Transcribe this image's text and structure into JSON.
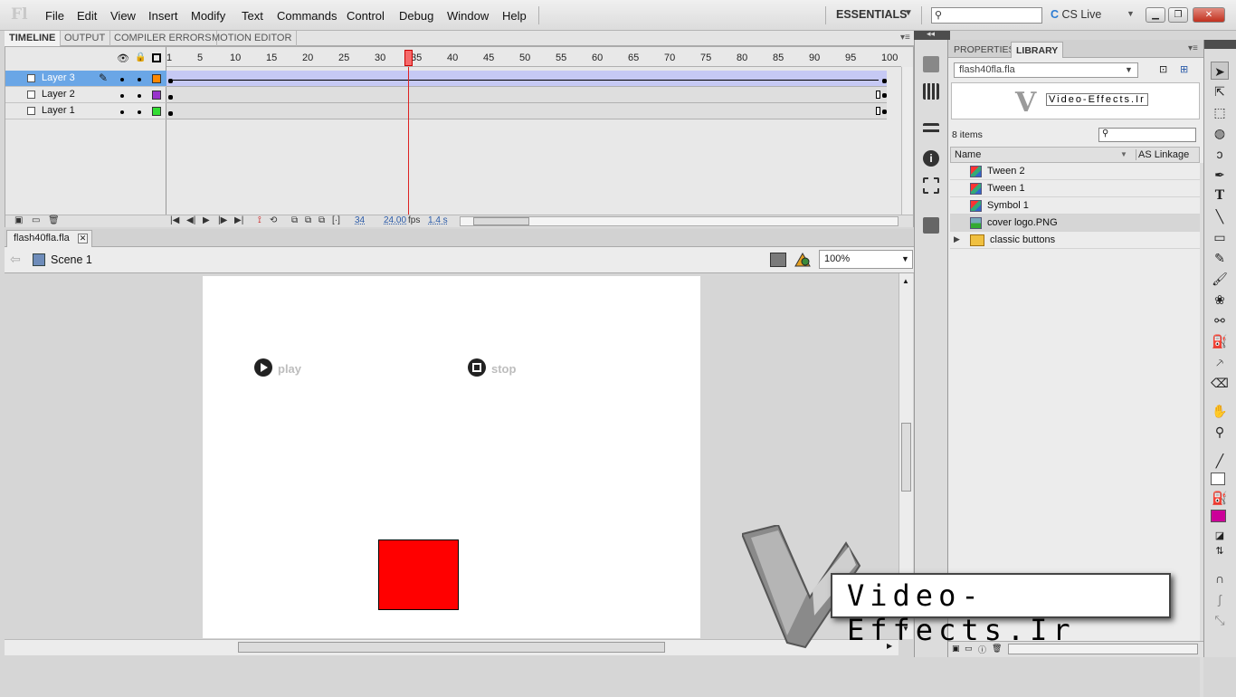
{
  "app": {
    "logo": "Fl",
    "workspace": "ESSENTIALS",
    "cs_live": "CS Live"
  },
  "menu": [
    "File",
    "Edit",
    "View",
    "Insert",
    "Modify",
    "Text",
    "Commands",
    "Control",
    "Debug",
    "Window",
    "Help"
  ],
  "timeline": {
    "tabs": [
      "TIMELINE",
      "OUTPUT",
      "COMPILER ERRORS",
      "MOTION EDITOR"
    ],
    "layers": [
      {
        "name": "Layer 3",
        "color": "#ff8800"
      },
      {
        "name": "Layer 2",
        "color": "#9933cc"
      },
      {
        "name": "Layer 1",
        "color": "#33dd33"
      }
    ],
    "ruler": [
      "1",
      "5",
      "10",
      "15",
      "20",
      "25",
      "30",
      "35",
      "40",
      "45",
      "50",
      "55",
      "60",
      "65",
      "70",
      "75",
      "80",
      "85",
      "90",
      "95",
      "100"
    ],
    "current_frame": "34",
    "fps": "24.00",
    "fps_unit": "fps",
    "elapsed": "1.4 s"
  },
  "document": {
    "tab": "flash40fla.fla",
    "scene": "Scene 1",
    "zoom": "100%"
  },
  "stage": {
    "play_label": "play",
    "stop_label": "stop"
  },
  "library": {
    "tabs": [
      "PROPERTIES",
      "LIBRARY"
    ],
    "file": "flash40fla.fla",
    "preview_text": "Video-Effects.Ir",
    "count": "8 items",
    "columns": {
      "name": "Name",
      "linkage": "AS Linkage"
    },
    "items": [
      {
        "label": "Tween 2",
        "icon": "symbol-icon"
      },
      {
        "label": "Tween 1",
        "icon": "symbol-icon"
      },
      {
        "label": "Symbol 1",
        "icon": "symbol-icon"
      },
      {
        "label": "cover logo.PNG",
        "icon": "bitmap-icon"
      },
      {
        "label": "classic buttons",
        "icon": "folder-icon"
      }
    ]
  },
  "watermark": {
    "text": "Video-Effects.Ir"
  }
}
